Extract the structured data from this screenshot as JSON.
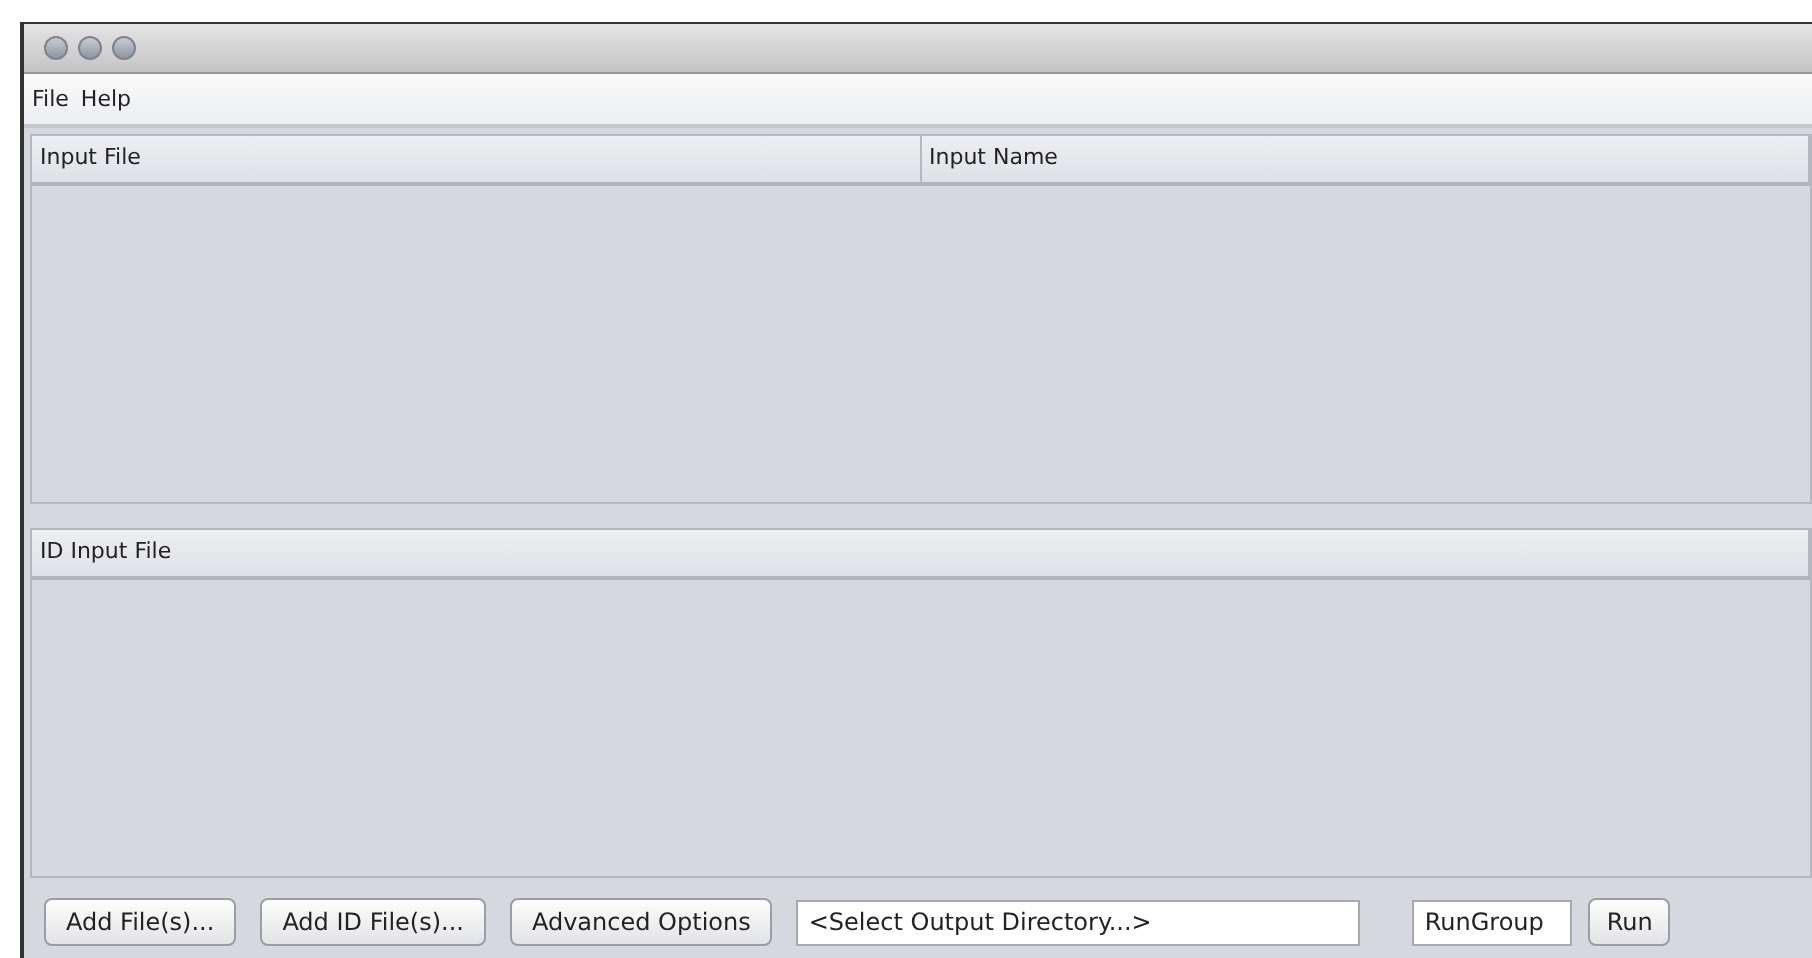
{
  "menu": [
    "File",
    "Help"
  ],
  "input_table": {
    "columns": [
      "Input File",
      "Input Name"
    ]
  },
  "id_table": {
    "columns": [
      "ID Input File"
    ]
  },
  "buttons": [
    "Add File(s)...",
    "Add ID File(s)...",
    "Advanced Options"
  ],
  "output_directory": {
    "value": "<Select Output Directory...>"
  },
  "group_name": {
    "value": "RunGroup"
  },
  "run_button": "Run"
}
